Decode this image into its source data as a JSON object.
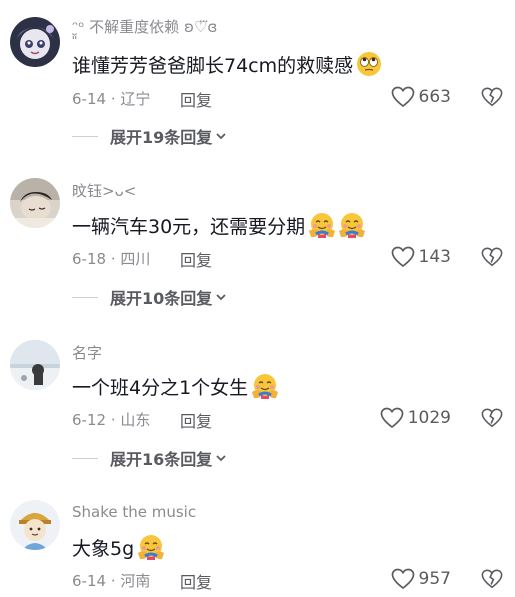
{
  "comments": [
    {
      "username": "ᵔ̮͈ᵒ 不解重度依赖 ʚ♡⃛ɞ",
      "text": "谁懂芳芳爸爸脚长74cm的救赎感",
      "emojis": [
        "rolling-eyes-emoji"
      ],
      "date": "6-14",
      "location": "辽宁",
      "reply_label": "回复",
      "likes": "663",
      "expand_label": "展开19条回复",
      "avatar": "anime-avatar"
    },
    {
      "username": "旼钰>ᴗ<",
      "text": "一辆汽车30元，还需要分期",
      "emojis": [
        "hug-emoji",
        "hug-emoji"
      ],
      "date": "6-18",
      "location": "四川",
      "reply_label": "回复",
      "likes": "143",
      "expand_label": "展开10条回复",
      "avatar": "photo-avatar"
    },
    {
      "username": "名字",
      "text": "一个班4分之1个女生",
      "emojis": [
        "hug-emoji"
      ],
      "date": "6-12",
      "location": "山东",
      "reply_label": "回复",
      "likes": "1029",
      "expand_label": "展开16条回复",
      "avatar": "photo-avatar"
    },
    {
      "username": "Shake the music",
      "text": "大象5g",
      "emojis": [
        "hug-emoji"
      ],
      "date": "6-14",
      "location": "河南",
      "reply_label": "回复",
      "likes": "957",
      "avatar": "cartoon-avatar"
    }
  ],
  "date_separator": " · ",
  "colors": {
    "text": "#161823",
    "meta": "#8a8b91",
    "action": "#5a5b61"
  }
}
